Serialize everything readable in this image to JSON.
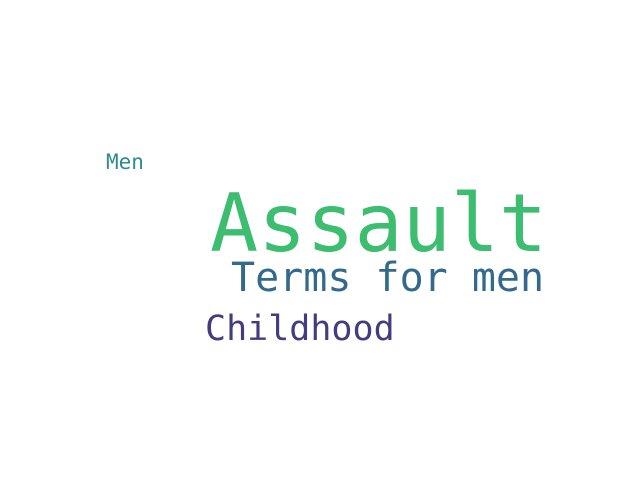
{
  "words": [
    {
      "text": "Men",
      "color": "#2d8a90"
    },
    {
      "text": "Assault",
      "color": "#3cbd70"
    },
    {
      "text": "Terms for men",
      "color": "#33698d"
    },
    {
      "text": "Childhood",
      "color": "#443c80"
    }
  ],
  "background_color": "#ffffff"
}
